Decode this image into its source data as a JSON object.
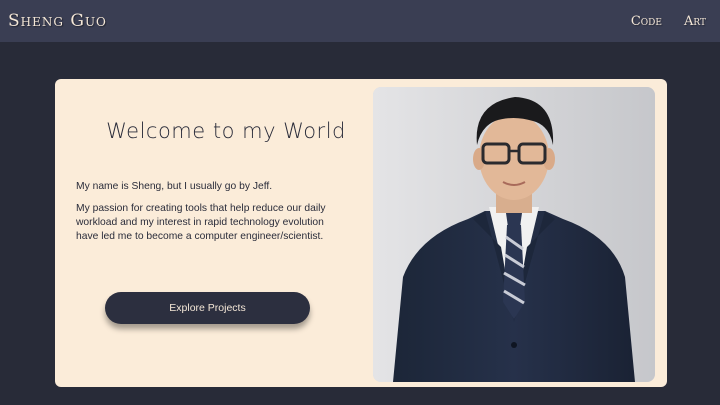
{
  "nav": {
    "logo": "Sheng Guo",
    "links": [
      "Code",
      "Art"
    ]
  },
  "hero": {
    "title": "Welcome to my World",
    "paragraphs": [
      "My name is Sheng, but I usually go by Jeff.",
      "My passion for creating tools that help reduce our daily workload and my interest in rapid technology evolution have led me to become a computer engineer/scientist."
    ],
    "button_label": "Explore Projects",
    "portrait_icon": "person-portrait-icon"
  },
  "colors": {
    "page_bg": "#282b38",
    "navbar_bg": "#3a3e53",
    "card_bg": "#fbecd9",
    "accent_text": "#f4e7d7",
    "button_bg": "#2c2f3f"
  }
}
